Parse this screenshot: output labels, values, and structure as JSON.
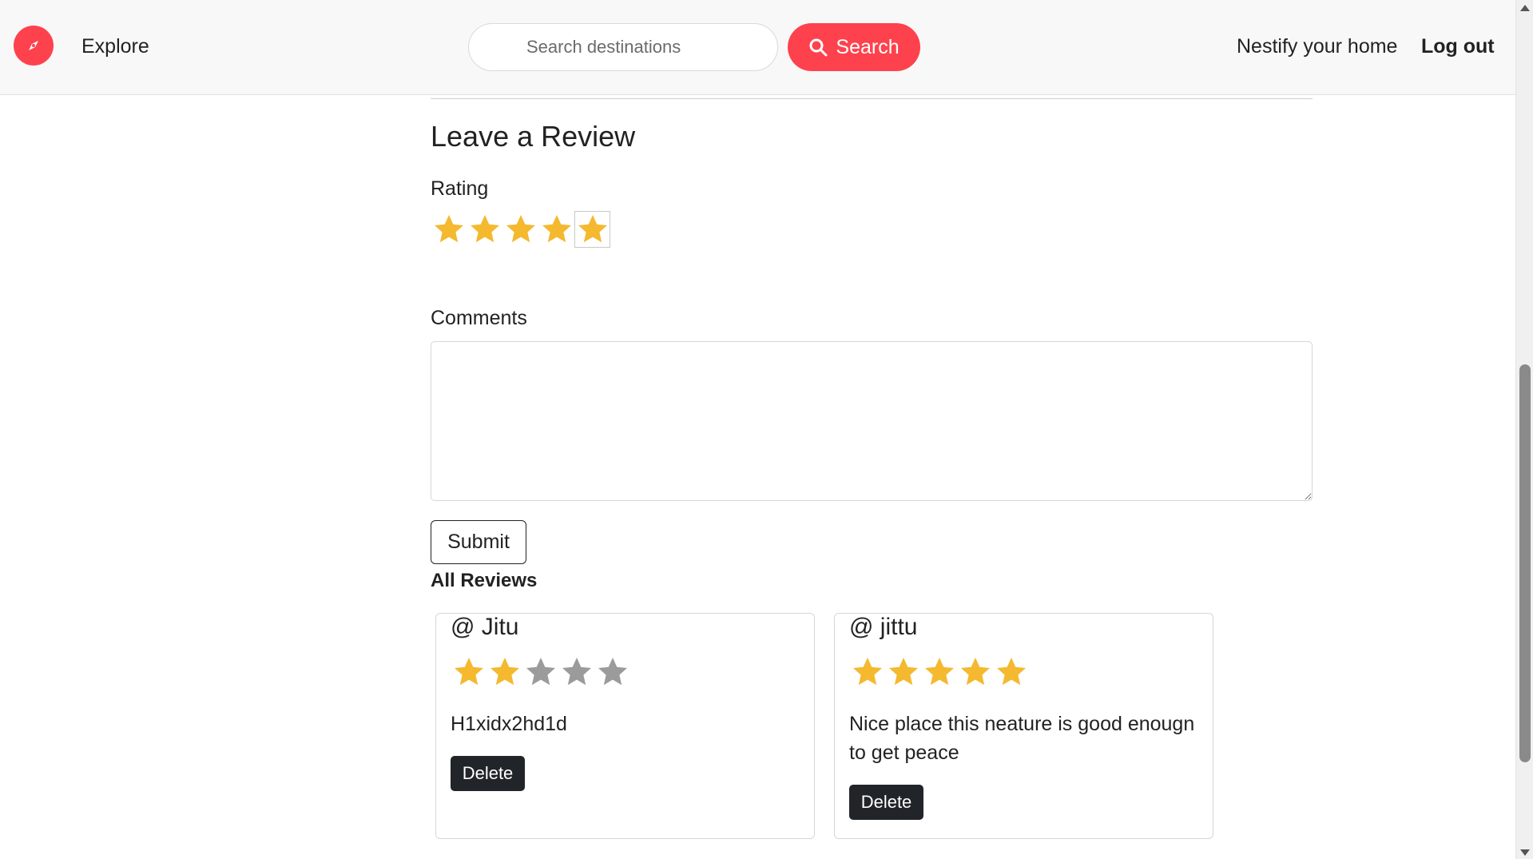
{
  "navbar": {
    "explore_label": "Explore",
    "search_placeholder": "Search destinations",
    "search_button_label": "Search",
    "host_link_label": "Nestify your home",
    "logout_label": "Log out"
  },
  "review_form": {
    "heading": "Leave a Review",
    "rating_label": "Rating",
    "rating_value": 5,
    "rating_max": 5,
    "comments_label": "Comments",
    "comments_value": "",
    "submit_label": "Submit"
  },
  "reviews": {
    "heading": "All Reviews",
    "items": [
      {
        "author": "@ Jitu",
        "rating": 2,
        "comment": "H1xidx2hd1d",
        "delete_label": "Delete"
      },
      {
        "author": "@ jittu",
        "rating": 5,
        "comment": "Nice place this neature is good enougn to get peace",
        "delete_label": "Delete"
      }
    ]
  },
  "colors": {
    "brand": "#fe424d",
    "star_filled": "#f4b92f",
    "star_empty": "#9b9b9b",
    "delete_bg": "#212529",
    "navbar_bg": "#f8f8f8"
  },
  "icons": {
    "brand": "compass-icon",
    "search": "search-icon",
    "star": "star-icon"
  }
}
